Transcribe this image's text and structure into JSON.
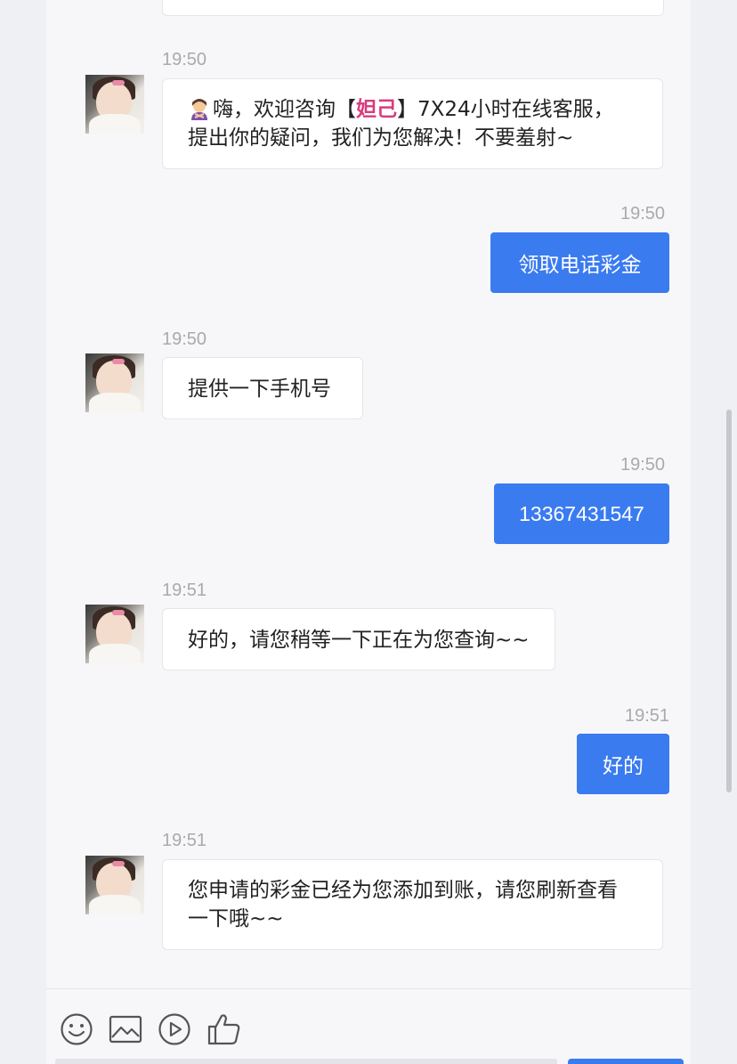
{
  "messages": [
    {
      "side": "in",
      "time": "19:50",
      "emoji": "woman-gesturing-emoji",
      "line1_pre": "嗨，欢迎咨询【",
      "brand": "妲己",
      "line1_post": "】7X24小时在线客服，",
      "line2": "提出你的疑问，我们为您解决！不要羞射~"
    },
    {
      "side": "out",
      "time": "19:50",
      "text": "领取电话彩金"
    },
    {
      "side": "in",
      "time": "19:50",
      "text": "提供一下手机号"
    },
    {
      "side": "out",
      "time": "19:50",
      "text": "13367431547"
    },
    {
      "side": "in",
      "time": "19:51",
      "text": "好的，请您稍等一下正在为您查询~~"
    },
    {
      "side": "out",
      "time": "19:51",
      "text": "好的"
    },
    {
      "side": "in",
      "time": "19:51",
      "line1": "您申请的彩金已经为您添加到账，请您刷新查看",
      "line2": "一下哦~~"
    }
  ],
  "toolbar": {
    "icons": [
      "smiley-icon",
      "image-icon",
      "play-icon",
      "thumbs-up-icon"
    ]
  },
  "colors": {
    "accent": "#3a7bf0",
    "brand": "#d93b7c",
    "timestamp": "#a9a9ae"
  }
}
